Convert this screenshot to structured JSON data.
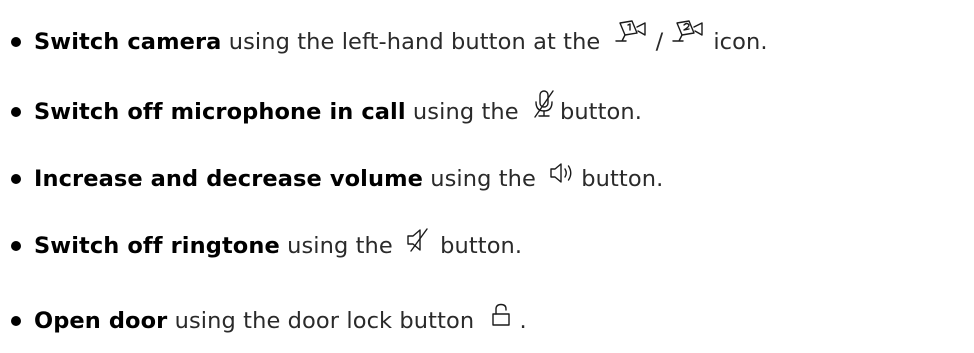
{
  "items": [
    {
      "bold": "Switch camera",
      "before_icon": " using the left-hand button at the ",
      "separator": "/",
      "after_icon": "icon.",
      "icons": [
        "camera-1-icon",
        "camera-2-icon"
      ]
    },
    {
      "bold": "Switch off microphone in call",
      "before_icon": " using the ",
      "after_icon": "button.",
      "icons": [
        "microphone-off-icon"
      ]
    },
    {
      "bold": "Increase and decrease volume",
      "before_icon": " using the ",
      "after_icon": "button.",
      "icons": [
        "speaker-volume-icon"
      ]
    },
    {
      "bold": "Switch off ringtone",
      "before_icon": " using the ",
      "after_icon": "button.",
      "icons": [
        "speaker-mute-icon"
      ]
    },
    {
      "bold": "Open door",
      "before_icon": " using the door lock button ",
      "after_icon": ".",
      "icons": [
        "lock-open-icon"
      ]
    }
  ],
  "colors": {
    "text": "#2a2a2a",
    "bold": "#000000",
    "icon": "#1a1a1a"
  }
}
